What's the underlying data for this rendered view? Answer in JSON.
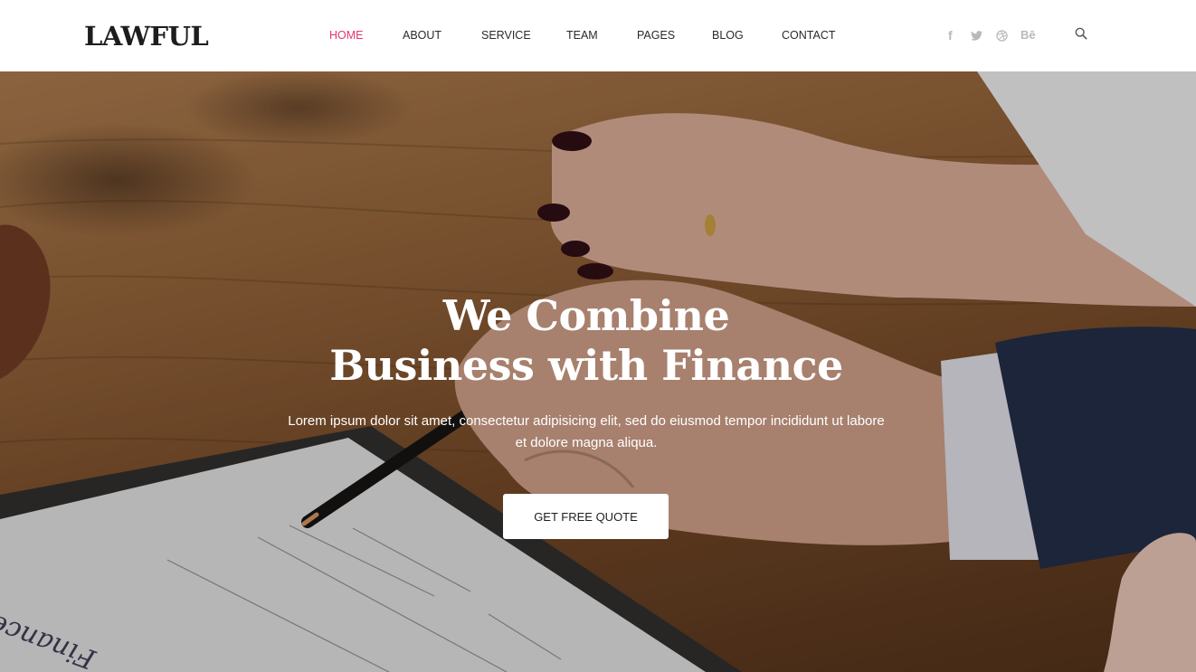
{
  "header": {
    "logo": "LAWFUL",
    "nav": [
      {
        "label": "HOME",
        "active": true
      },
      {
        "label": "ABOUT",
        "active": false
      },
      {
        "label": "SERVICE",
        "active": false
      },
      {
        "label": "TEAM",
        "active": false
      },
      {
        "label": "PAGES",
        "active": false
      },
      {
        "label": "BLOG",
        "active": false
      },
      {
        "label": "CONTACT",
        "active": false
      }
    ],
    "social": [
      {
        "icon": "facebook-icon",
        "glyph": "f"
      },
      {
        "icon": "twitter-icon",
        "glyph": "🐦"
      },
      {
        "icon": "dribbble-icon",
        "glyph": "⊛"
      },
      {
        "icon": "behance-icon",
        "glyph": "Bē"
      }
    ],
    "search_icon": "search-icon"
  },
  "hero": {
    "title_line1": "We Combine",
    "title_line2": "Business with Finance",
    "description": "Lorem ipsum dolor sit amet, consectetur adipisicing elit, sed do eiusmod tempor incididunt ut labore et dolore magna aliqua.",
    "cta_label": "GET FREE QUOTE",
    "background": "photo-hands-signing-document-on-wooden-desk"
  },
  "colors": {
    "accent": "#e5366f",
    "nav_text": "#2a2a2a",
    "social_icon": "#b9b9b9",
    "hero_text": "#ffffff"
  }
}
